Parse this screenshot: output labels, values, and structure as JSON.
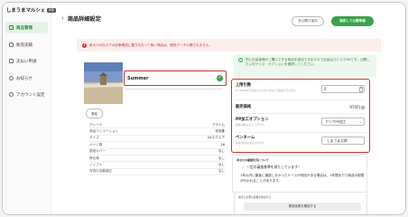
{
  "app": {
    "title": "しまうまマルシェ",
    "tag": "β版"
  },
  "sidebar": {
    "items": [
      {
        "label": "商品管理",
        "icon": "box-icon",
        "active": true
      },
      {
        "label": "販売実績",
        "icon": "chart-icon"
      },
      {
        "label": "支払い申請",
        "icon": "wallet-icon"
      },
      {
        "label": "お知らせ",
        "icon": "bell-icon"
      },
      {
        "label": "アカウント設定",
        "icon": "user-icon"
      }
    ]
  },
  "header": {
    "title": "商品詳細設定",
    "back_icon": "chevron-left-icon",
    "draft_button": "非公開で保存",
    "publish_button": "保存して公開申請"
  },
  "alert": {
    "text": "各々100日以下の記事確認に置きなおって無い場合は、販売データ公開されません。",
    "color": "#cc3333"
  },
  "product": {
    "name": "Summer",
    "thumb_label": "表紙",
    "image_colors": {
      "sky": "#5d7fb8",
      "sand": "#cbbb9b"
    }
  },
  "specs": [
    {
      "label": "グレード",
      "value": "プライム"
    },
    {
      "label": "商品バリエーション",
      "value": "写真集"
    },
    {
      "label": "サイズ",
      "value": "A4スクエア"
    },
    {
      "label": "ページ数",
      "value": "26"
    },
    {
      "label": "表紙カバー",
      "value": "なし"
    },
    {
      "label": "帯仕様",
      "value": "なし"
    },
    {
      "label": "ノンブル",
      "value": "なし"
    },
    {
      "label": "写真の自動補正",
      "value": "なし"
    }
  ],
  "info": {
    "text": "同じ出品者様がご購入できる商品を追加できますので出品はひとつでOKです。公開したいおサイズ・オプションを選択してください。"
  },
  "form": {
    "upper_limit": {
      "label": "上限引数",
      "hint": "0〜20,000円で指定できます。0円以下は指定できません。",
      "value": "0",
      "unit": "円"
    },
    "price": {
      "label": "販売価格",
      "value": "970",
      "unit": "円"
    },
    "pp_option": {
      "label": "PP加工オプション",
      "hint": "利用可能はないとされます。",
      "value": "クリアPP加工"
    },
    "pen_name": {
      "label": "ペンネーム",
      "hint": "筆者の名前が表示されます。",
      "value": "しまうま太郎"
    }
  },
  "status_card": {
    "title": "あなたの審査状況について",
    "status": "一定の審査基準を満たしています！",
    "description": "1年以内に審査に通過しなかったケースが何回かある場合は、1年間あたり商品の制限が行われることがあります。"
  },
  "image_card": {
    "title": "審査に必要な画像を確認する",
    "button": "審査画像を確認する"
  }
}
